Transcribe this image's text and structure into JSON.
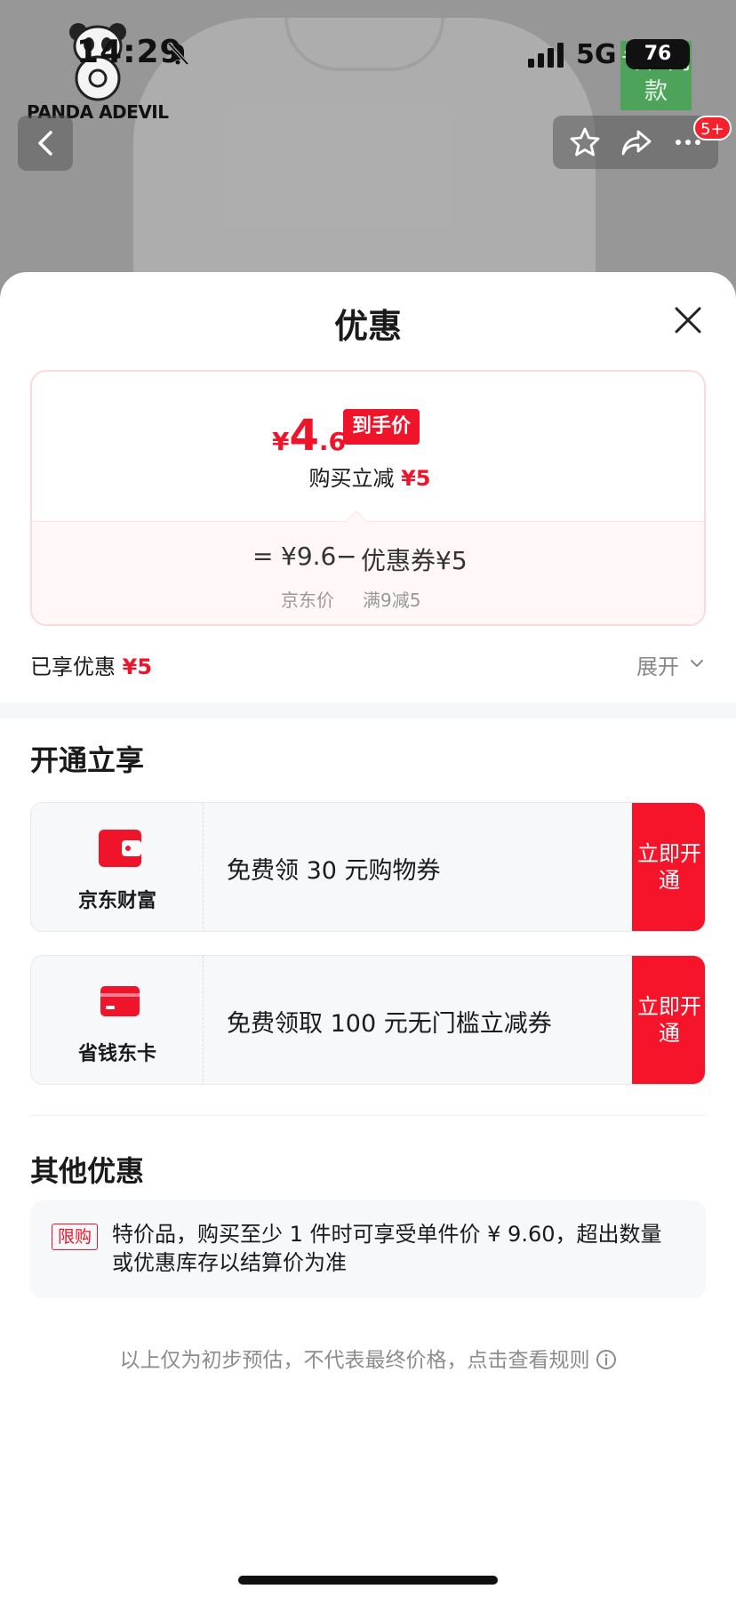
{
  "status_bar": {
    "time": "14:29",
    "network": "5G",
    "battery": "76"
  },
  "background": {
    "brand_name": "PANDA ADEVIL",
    "green_tag": "专柜同款",
    "badge_count": "5+"
  },
  "sheet": {
    "title": "优惠",
    "price_card": {
      "currency": "¥",
      "final_int": "4",
      "final_dec": ".6",
      "final_tag": "到手价",
      "reduce_label": "购买立减",
      "reduce_amount": "¥5",
      "formula": {
        "equals": "=",
        "jd_price": "¥9.6",
        "minus": "−",
        "coupon": "优惠券¥5",
        "jd_price_label": "京东价",
        "coupon_rule": "满9减5"
      }
    },
    "enjoyed": {
      "label": "已享优惠",
      "amount": "¥5",
      "expand": "展开"
    },
    "open_section": {
      "title": "开通立享",
      "items": [
        {
          "name": "京东财富",
          "desc": "免费领 30 元购物券",
          "button": "立即开通",
          "icon": "wallet-icon"
        },
        {
          "name": "省钱东卡",
          "desc": "免费领取 100 元无门槛立减券",
          "button": "立即开通",
          "icon": "card-icon"
        }
      ]
    },
    "other_section": {
      "title": "其他优惠",
      "tag": "限购",
      "text": "特价品，购买至少 1 件时可享受单件价 ¥ 9.60，超出数量或优惠库存以结算价为准"
    },
    "disclaimer": "以上仅为初步预估，不代表最终价格，点击查看规则"
  },
  "colors": {
    "accent_red": "#f0142a",
    "muted": "#8c8c8c"
  }
}
